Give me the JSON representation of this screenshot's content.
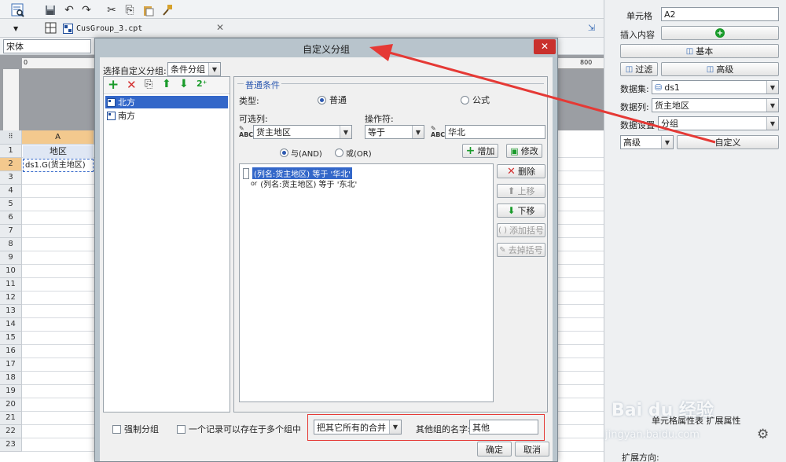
{
  "app": {
    "file_tab": "CusGroup_3.cpt",
    "font_name": "宋体",
    "ruler_end": "800",
    "ruler_start": "0"
  },
  "sheet": {
    "column_header": "A",
    "rows": [
      "1",
      "2",
      "3",
      "4",
      "5",
      "6",
      "7",
      "8",
      "9",
      "10",
      "11",
      "12",
      "13",
      "14",
      "15",
      "16",
      "17",
      "18",
      "19",
      "20",
      "21",
      "22",
      "23"
    ],
    "cell_a1": "地区",
    "cell_a2": "ds1.G(货主地区)"
  },
  "dialog": {
    "title": "自定义分组",
    "select_label": "选择自定义分组:",
    "select_value": "条件分组",
    "groups": [
      "北方",
      "南方"
    ],
    "section_title": "普通条件",
    "type_label": "类型:",
    "type_normal": "普通",
    "type_formula": "公式",
    "column_label": "可选列:",
    "operator_label": "操作符:",
    "column_value": "货主地区",
    "operator_value": "等于",
    "value_text": "华北",
    "and_label": "与(AND)",
    "or_label": "或(OR)",
    "add_button": "增加",
    "modify_button": "修改",
    "conditions": [
      {
        "prefix": "",
        "text": "(列名:货主地区) 等于 '华北'"
      },
      {
        "prefix": "or",
        "text": "(列名:货主地区) 等于 '东北'"
      }
    ],
    "side_buttons": {
      "delete": "删除",
      "up": "上移",
      "down": "下移",
      "add_bracket": "添加括号",
      "remove_bracket": "去掉括号"
    },
    "force_group": "强制分组",
    "multi_group": "一个记录可以存在于多个组中",
    "merge_option": "把其它所有的合并",
    "other_name_label": "其他组的名字:",
    "other_name_value": "其他",
    "ok": "确定",
    "cancel": "取消"
  },
  "right_panel": {
    "cell_label": "单元格",
    "cell_value": "A2",
    "insert_label": "插入内容",
    "basic": "基本",
    "filter": "过滤",
    "advanced": "高级",
    "dataset_label": "数据集:",
    "dataset_value": "ds1",
    "column_label": "数据列:",
    "column_value": "货主地区",
    "setting_label": "数据设置",
    "setting_value": "分组",
    "mode_value": "高级",
    "custom_button": "自定义",
    "bottom_tabs": "单元格属性表 扩展属性",
    "expand_label": "扩展方向:"
  },
  "watermark": {
    "brand": "Bai du 经验",
    "url": "jingyan.baidu.com"
  },
  "colors": {
    "dialog_title_bg": "#b8c4cc",
    "close_red": "#c9302c",
    "selection_blue": "#3367c9",
    "arrow_red": "#e53935",
    "green": "#1a9b2b"
  }
}
